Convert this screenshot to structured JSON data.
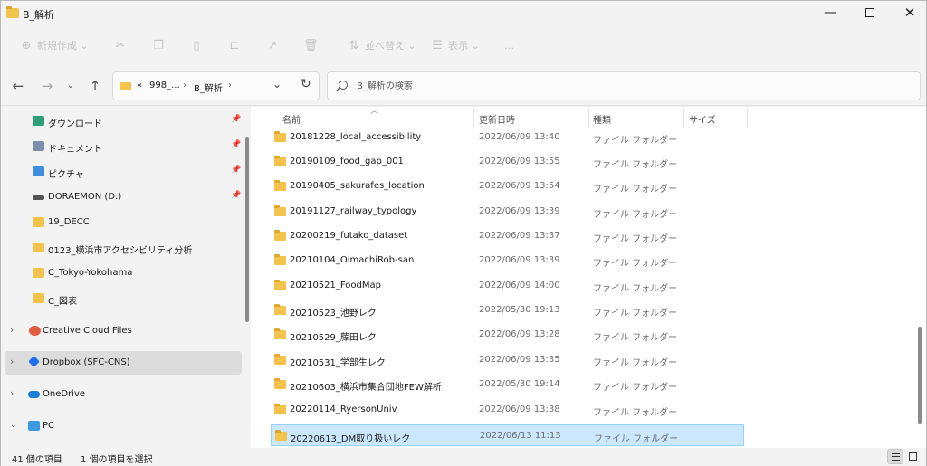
{
  "window": {
    "title": "B_解析",
    "min_glyph": "—",
    "close_glyph": "✕"
  },
  "toolbar": {
    "new_label": "新規作成",
    "sort_label": "並べ替え",
    "view_label": "表示",
    "more_label": "…"
  },
  "address": {
    "overflow": "«",
    "segments": [
      "998_...",
      "B_解析"
    ],
    "separator": "›"
  },
  "search": {
    "placeholder": "B_解析の検索"
  },
  "sidebar": {
    "items": [
      {
        "label": "ダウンロード",
        "icon": "download-icon",
        "pinned": true
      },
      {
        "label": "ドキュメント",
        "icon": "documents-icon",
        "pinned": true
      },
      {
        "label": "ピクチャ",
        "icon": "pictures-icon",
        "pinned": true
      },
      {
        "label": "DORAEMON (D:)",
        "icon": "drive-icon",
        "pinned": true
      },
      {
        "label": "19_DECC",
        "icon": "folder-icon",
        "pinned": false
      },
      {
        "label": "0123_横浜市アクセシビリティ分析",
        "icon": "folder-icon",
        "pinned": false
      },
      {
        "label": "C_Tokyo-Yokohama",
        "icon": "folder-icon",
        "pinned": false
      },
      {
        "label": "C_図表",
        "icon": "folder-icon",
        "pinned": false
      },
      {
        "label": "Creative Cloud Files",
        "icon": "creative-cloud-icon",
        "pinned": false
      },
      {
        "label": "Dropbox (SFC-CNS)",
        "icon": "dropbox-icon",
        "pinned": false
      },
      {
        "label": "OneDrive",
        "icon": "onedrive-icon",
        "pinned": false
      },
      {
        "label": "PC",
        "icon": "pc-icon",
        "pinned": false
      }
    ]
  },
  "columns": {
    "name": "名前",
    "modified": "更新日時",
    "type": "種類",
    "size": "サイズ"
  },
  "files": [
    {
      "name": "20181228_local_accessibility",
      "modified": "2022/06/09 13:40",
      "type": "ファイル フォルダー"
    },
    {
      "name": "20190109_food_gap_001",
      "modified": "2022/06/09 13:55",
      "type": "ファイル フォルダー"
    },
    {
      "name": "20190405_sakurafes_location",
      "modified": "2022/06/09 13:54",
      "type": "ファイル フォルダー"
    },
    {
      "name": "20191127_railway_typology",
      "modified": "2022/06/09 13:39",
      "type": "ファイル フォルダー"
    },
    {
      "name": "20200219_futako_dataset",
      "modified": "2022/06/09 13:37",
      "type": "ファイル フォルダー"
    },
    {
      "name": "20210104_OimachiRob-san",
      "modified": "2022/06/09 13:39",
      "type": "ファイル フォルダー"
    },
    {
      "name": "20210521_FoodMap",
      "modified": "2022/06/09 14:00",
      "type": "ファイル フォルダー"
    },
    {
      "name": "20210523_池野レク",
      "modified": "2022/05/30 19:13",
      "type": "ファイル フォルダー"
    },
    {
      "name": "20210529_藤田レク",
      "modified": "2022/06/09 13:28",
      "type": "ファイル フォルダー"
    },
    {
      "name": "20210531_学部生レク",
      "modified": "2022/06/09 13:35",
      "type": "ファイル フォルダー"
    },
    {
      "name": "20210603_横浜市集合団地FEW解析",
      "modified": "2022/05/30 19:14",
      "type": "ファイル フォルダー"
    },
    {
      "name": "20220114_RyersonUniv",
      "modified": "2022/06/09 13:38",
      "type": "ファイル フォルダー"
    },
    {
      "name": "20220613_DM取り扱いレク",
      "modified": "2022/06/13 11:13",
      "type": "ファイル フォルダー"
    }
  ],
  "status": {
    "item_count": "41 個の項目",
    "selected_count": "1 個の項目を選択"
  },
  "colors": {
    "accent": "#0067c0",
    "selection": "#cce8ff",
    "folder": "#f3c34d"
  }
}
